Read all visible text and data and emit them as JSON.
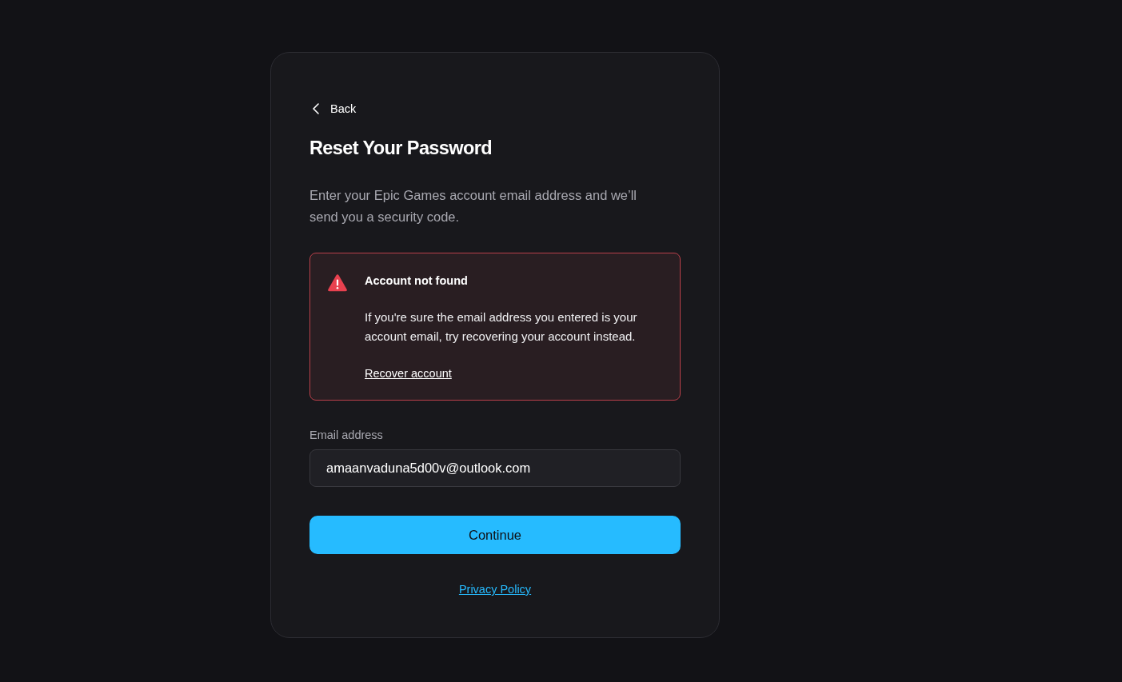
{
  "back_link": {
    "label": "Back"
  },
  "title": "Reset Your Password",
  "description": "Enter your Epic Games account email address and we’ll send you a security code.",
  "alert": {
    "kind": "error",
    "title": "Account not found",
    "message": "If you're sure the email address you entered is your account email, try recovering your account instead.",
    "link": "Recover account"
  },
  "email_field": {
    "label": "Email address",
    "value": "amaanvaduna5d00v@outlook.com"
  },
  "continue_button": {
    "label": "Continue"
  },
  "privacy_link": {
    "label": "Privacy Policy"
  }
}
